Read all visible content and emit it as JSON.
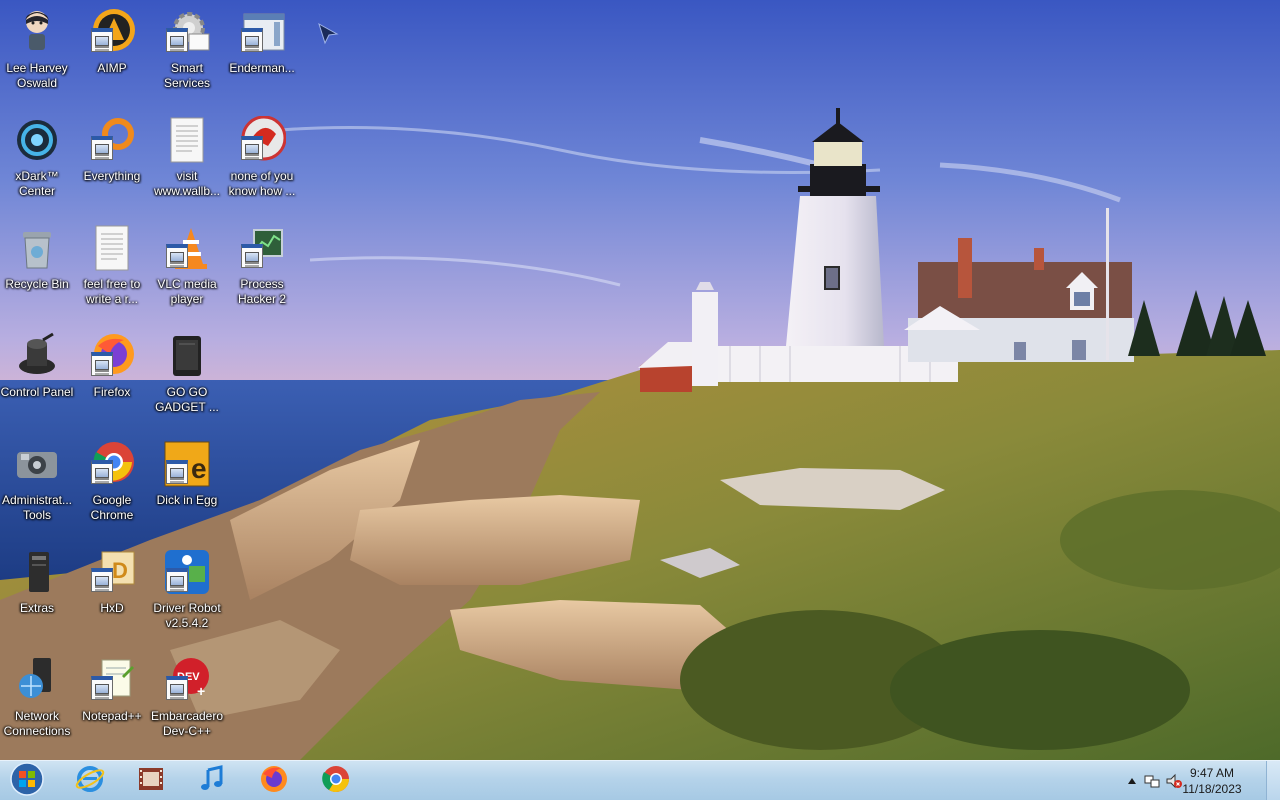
{
  "desktop": {
    "icons": [
      {
        "label": "Lee Harvey Oswald",
        "icon": "anime-character-icon"
      },
      {
        "label": "AIMP",
        "icon": "aimp-icon"
      },
      {
        "label": "Smart Services",
        "icon": "gear-icon"
      },
      {
        "label": "Enderman...",
        "icon": "enderman-app-icon"
      },
      {
        "label": "xDark™ Center",
        "icon": "xdark-center-icon"
      },
      {
        "label": "Everything",
        "icon": "everything-search-icon"
      },
      {
        "label": "visit www.wallb...",
        "icon": "text-document-icon"
      },
      {
        "label": "none of you know how ...",
        "icon": "red-app-icon"
      },
      {
        "label": "Recycle Bin",
        "icon": "recycle-bin-icon"
      },
      {
        "label": "feel free to write a r...",
        "icon": "text-document-icon"
      },
      {
        "label": "VLC media player",
        "icon": "vlc-cone-icon"
      },
      {
        "label": "Process Hacker 2",
        "icon": "process-hacker-icon"
      },
      {
        "label": "Control Panel",
        "icon": "control-panel-icon"
      },
      {
        "label": "Firefox",
        "icon": "firefox-icon"
      },
      {
        "label": "GO GO GADGET ...",
        "icon": "gadget-icon"
      },
      {
        "label": "Administrat... Tools",
        "icon": "admin-tools-icon"
      },
      {
        "label": "Google Chrome",
        "icon": "chrome-icon"
      },
      {
        "label": "Dick in Egg",
        "icon": "egg-app-icon"
      },
      {
        "label": "Extras",
        "icon": "extras-icon"
      },
      {
        "label": "HxD",
        "icon": "hxd-icon"
      },
      {
        "label": "Driver Robot v2.5.4.2",
        "icon": "driver-robot-icon"
      },
      {
        "label": "Network Connections",
        "icon": "network-connections-icon"
      },
      {
        "label": "Notepad++",
        "icon": "notepad-plus-plus-icon"
      },
      {
        "label": "Embarcadero Dev-C++",
        "icon": "dev-cpp-icon"
      }
    ]
  },
  "taskbar": {
    "start_icon": "windows-orb-icon",
    "pinned": [
      {
        "name": "internet-explorer",
        "icon": "internet-explorer-icon"
      },
      {
        "name": "media-center",
        "icon": "film-strip-icon"
      },
      {
        "name": "music-player",
        "icon": "music-note-icon"
      },
      {
        "name": "firefox",
        "icon": "firefox-icon"
      },
      {
        "name": "chrome",
        "icon": "chrome-icon"
      }
    ],
    "tray": {
      "show_hidden_icon": "chevron-up-icon",
      "network_icon": "network-icon",
      "volume_icon": "volume-muted-icon",
      "time": "9:47 AM",
      "date": "11/18/2023"
    }
  },
  "colors": {
    "sky_top": "#3f5fc4",
    "sea": "#2a4f9a",
    "taskbar": "#b5d3ea",
    "label_text": "#ffffff"
  }
}
